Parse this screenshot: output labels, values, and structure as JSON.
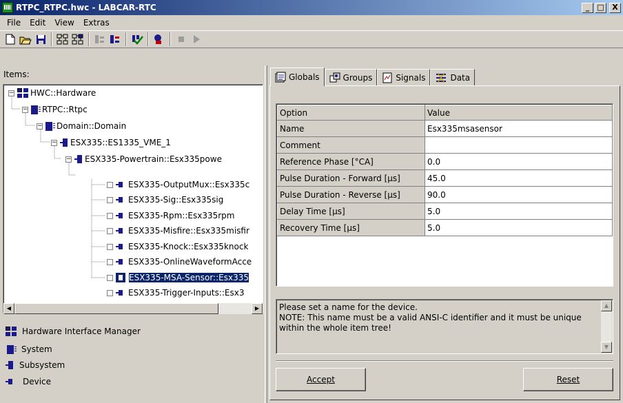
{
  "window": {
    "title": "RTPC_RTPC.hwc - LABCAR-RTC",
    "controls": {
      "minimize": "_",
      "maximize": "□",
      "close": "X"
    }
  },
  "menu": [
    "File",
    "Edit",
    "View",
    "Extras"
  ],
  "toolbar": {
    "icons": [
      "new-document-icon",
      "open-folder-icon",
      "save-icon",
      "add-system-icon",
      "add-subsystem-icon",
      "remove-item-icon",
      "move-item-icon",
      "check-icon",
      "connect-icon",
      "stop-icon",
      "run-icon"
    ]
  },
  "left": {
    "items_label": "Items:",
    "tree": [
      {
        "label": "HWC::Hardware",
        "type": "hwc",
        "expander": "−"
      },
      {
        "label": "RTPC::Rtpc",
        "type": "system",
        "expander": "−"
      },
      {
        "label": "Domain::Domain",
        "type": "system",
        "expander": "−"
      },
      {
        "label": "ESX335::ES1335_VME_1",
        "type": "subsystem",
        "expander": "−"
      },
      {
        "label": "ESX335-Powertrain::Esx335powe",
        "type": "subsystem",
        "expander": "−"
      },
      {
        "label": "ESX335-OutputMux::Esx335c",
        "type": "device",
        "expander": ""
      },
      {
        "label": "ESX335-Sig::Esx335sig",
        "type": "device",
        "expander": ""
      },
      {
        "label": "ESX335-Rpm::Esx335rpm",
        "type": "device",
        "expander": ""
      },
      {
        "label": "ESX335-Misfire::Esx335misfir",
        "type": "device",
        "expander": ""
      },
      {
        "label": "ESX335-Knock::Esx335knock",
        "type": "device",
        "expander": ""
      },
      {
        "label": "ESX335-OnlineWaveformAcce",
        "type": "device",
        "expander": ""
      },
      {
        "label": "ESX335-MSA-Sensor::Esx335",
        "type": "device",
        "expander": "",
        "selected": true
      },
      {
        "label": "ESX335-Trigger-Inputs::Esx3",
        "type": "device",
        "expander": ""
      }
    ],
    "legend": [
      {
        "label": "Hardware Interface Manager",
        "type": "hwc"
      },
      {
        "label": "System",
        "type": "system"
      },
      {
        "label": "Subsystem",
        "type": "subsystem"
      },
      {
        "label": "Device",
        "type": "device"
      }
    ]
  },
  "right": {
    "tabs": [
      {
        "label": "Globals",
        "icon": "globals-icon",
        "active": true
      },
      {
        "label": "Groups",
        "icon": "groups-icon"
      },
      {
        "label": "Signals",
        "icon": "signals-icon"
      },
      {
        "label": "Data",
        "icon": "data-icon"
      }
    ],
    "table": {
      "headers": [
        "Option",
        "Value"
      ],
      "rows": [
        [
          "Name",
          "Esx335msasensor"
        ],
        [
          "Comment",
          ""
        ],
        [
          "Reference Phase [°CA]",
          "0.0"
        ],
        [
          "Pulse Duration - Forward [µs]",
          "45.0"
        ],
        [
          "Pulse Duration - Reverse [µs]",
          "90.0"
        ],
        [
          "Delay Time [µs]",
          "5.0"
        ],
        [
          "Recovery Time [µs]",
          "5.0"
        ]
      ]
    },
    "hint": [
      "Please set a name for the device.",
      "NOTE: This name must be a valid ANSI-C identifier and it must be unique",
      "within the whole item tree!"
    ],
    "buttons": {
      "accept": "Accept",
      "reset": "Reset"
    }
  }
}
